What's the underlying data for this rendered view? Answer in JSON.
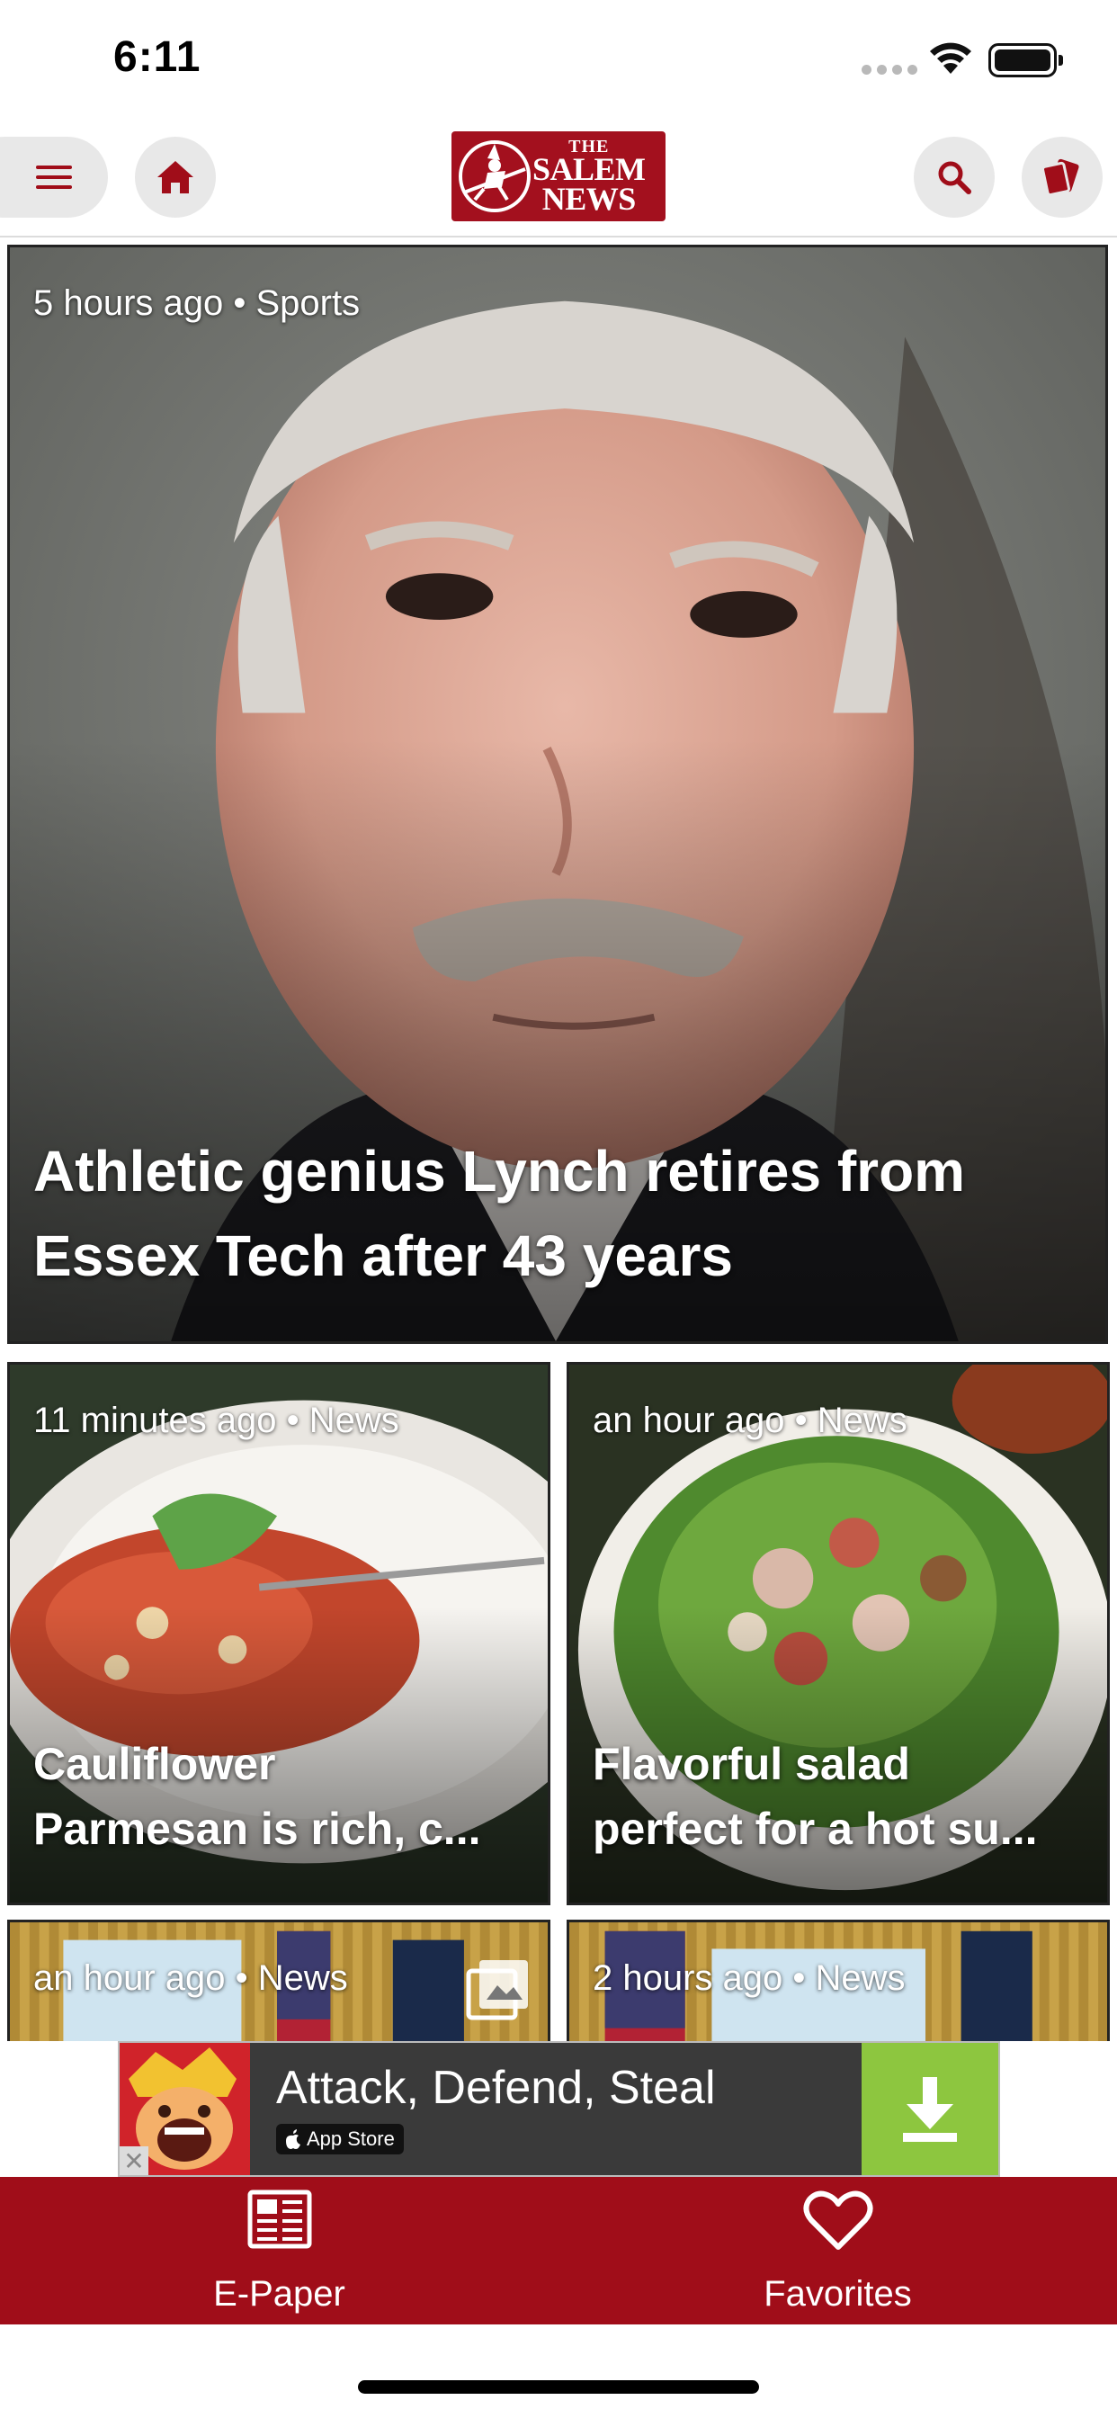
{
  "status_bar": {
    "time": "6:11"
  },
  "header": {
    "logo": {
      "the": "THE",
      "line1": "SALEM",
      "line2": "NEWS"
    },
    "icons": {
      "menu": "hamburger-icon",
      "home": "home-icon",
      "search": "search-icon",
      "cards": "cards-icon"
    }
  },
  "feed": {
    "hero": {
      "meta": "5 hours ago • Sports",
      "title": "Athletic genius Lynch retires from Essex Tech after 43 years"
    },
    "cards": [
      {
        "meta": "11 minutes ago • News",
        "title_line1": "Cauliflower",
        "title_line2": "Parmesan is rich, c..."
      },
      {
        "meta": "an hour ago • News",
        "title_line1": "Flavorful salad",
        "title_line2": "perfect for a hot su..."
      },
      {
        "meta": "an hour ago • News"
      },
      {
        "meta": "2 hours ago • News"
      }
    ]
  },
  "ad": {
    "title": "Attack, Defend, Steal",
    "store": "App Store",
    "download_icon": "download-icon",
    "close": "✕"
  },
  "tabbar": {
    "epaper_label": "E-Paper",
    "favorites_label": "Favorites"
  },
  "colors": {
    "brand": "#a00d19",
    "ad_button": "#8dc63f"
  }
}
